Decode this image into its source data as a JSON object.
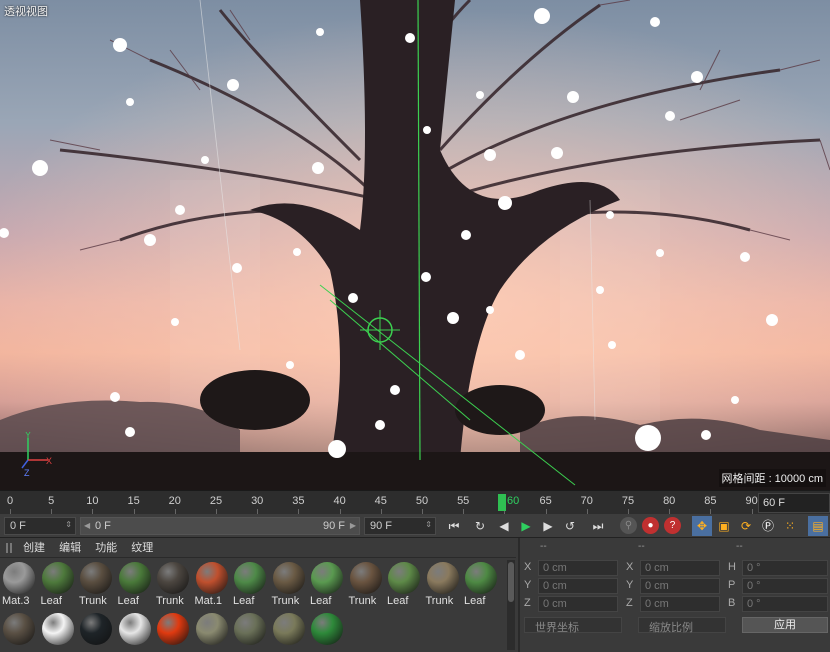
{
  "viewport": {
    "title": "透视视图",
    "grid_spacing": "网格间距 : 10000 cm",
    "axis_labels": {
      "x": "X",
      "y": "Y",
      "z": "Z"
    }
  },
  "timeline": {
    "ticks": [
      "0",
      "5",
      "10",
      "15",
      "20",
      "25",
      "30",
      "35",
      "40",
      "45",
      "50",
      "55",
      "60",
      "65",
      "70",
      "75",
      "80",
      "85",
      "90"
    ],
    "current_frame": "60",
    "end_field": "60 F"
  },
  "transport": {
    "start_field": "0 F",
    "range_start": "0 F",
    "range_end": "90 F",
    "end_field": "90 F"
  },
  "materials": {
    "menu": [
      "创建",
      "编辑",
      "功能",
      "纹理"
    ],
    "row1": [
      {
        "label": "Mat.3",
        "color": "#9a9a9a"
      },
      {
        "label": "Leaf",
        "color": "#4e7a3c"
      },
      {
        "label": "Trunk",
        "color": "#5a4e40"
      },
      {
        "label": "Leaf",
        "color": "#4a7a3a"
      },
      {
        "label": "Trunk",
        "color": "#4c4640"
      },
      {
        "label": "Mat.1",
        "color": "#c0502e"
      },
      {
        "label": "Leaf",
        "color": "#4e8a48"
      },
      {
        "label": "Trunk",
        "color": "#6a5a44"
      },
      {
        "label": "Leaf",
        "color": "#5a9a50"
      },
      {
        "label": "Trunk",
        "color": "#6a5440"
      },
      {
        "label": "Leaf",
        "color": "#5e8a48"
      },
      {
        "label": "Trunk",
        "color": "#8a7a5e"
      },
      {
        "label": "Leaf",
        "color": "#4e8a44"
      }
    ],
    "row2": [
      {
        "label": "",
        "color": "#5a5044"
      },
      {
        "label": "",
        "color": "#f4f4f4"
      },
      {
        "label": "",
        "color": "#1e2428"
      },
      {
        "label": "",
        "color": "#e6e6e6"
      },
      {
        "label": "",
        "color": "#e03a10"
      },
      {
        "label": "",
        "color": "#8a8a70"
      },
      {
        "label": "",
        "color": "#6a7058"
      },
      {
        "label": "",
        "color": "#7a7a5a"
      },
      {
        "label": "",
        "color": "#2e8a3a"
      }
    ]
  },
  "coordinates": {
    "headers": [
      "--",
      "--",
      "--"
    ],
    "rows": [
      {
        "a": "X",
        "av": "0 cm",
        "b": "X",
        "bv": "0 cm",
        "c": "H",
        "cv": "0 °"
      },
      {
        "a": "Y",
        "av": "0 cm",
        "b": "Y",
        "bv": "0 cm",
        "c": "P",
        "cv": "0 °"
      },
      {
        "a": "Z",
        "av": "0 cm",
        "b": "Z",
        "bv": "0 cm",
        "c": "B",
        "cv": "0 °"
      }
    ],
    "space_dropdown": "世界坐标",
    "scale_dropdown": "缩放比例",
    "apply": "应用"
  }
}
